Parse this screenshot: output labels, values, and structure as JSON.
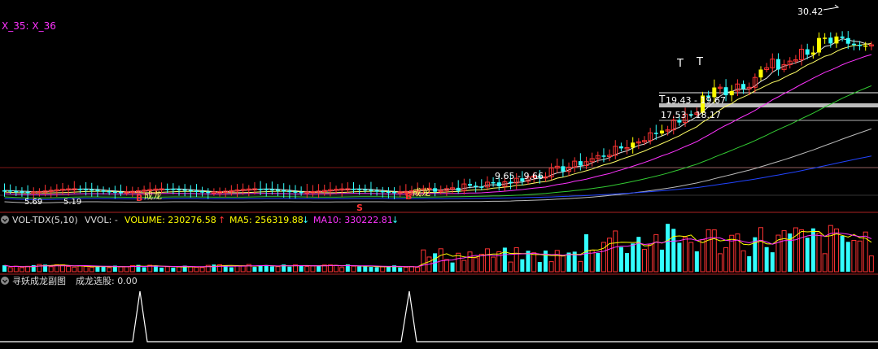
{
  "main_panel": {
    "legend": "X_35: X_36",
    "legend_color": "#ff33ff",
    "top_label": "30.42",
    "price_labels": [
      "19.43 - 19.67",
      "17.53 - 18.17",
      "9.65 - 9.66"
    ],
    "low_label": "5.69",
    "low_label_2": "5.19",
    "cheng_long_1": "成龙",
    "cheng_long_2": "成龙",
    "signal_b_1": "B",
    "signal_b_2": "B",
    "signal_s": "S",
    "marker_t1": "T",
    "marker_t2": "T",
    "marker_t3": "T"
  },
  "volume_panel": {
    "indicator": "VOL-TDX(5,10)",
    "vvol": "VVOL: -",
    "volume_label": "VOLUME: 230276.58",
    "volume_arrow": "↑",
    "ma5_label": "MA5: 256319.88",
    "ma5_arrow": "↓",
    "ma10_label": "MA10: 330222.81",
    "ma10_arrow": "↓",
    "colors": {
      "volume": "#ffff00",
      "ma5": "#ffff00",
      "ma10": "#ff33ff",
      "up_arrow": "#ff3333",
      "down_arrow": "#33ffff"
    }
  },
  "sub_panel": {
    "title": "寻妖成龙副图",
    "stock_pick_label": "成龙选股: 0.00"
  },
  "colors": {
    "background": "#000000",
    "up_candle": "#ff3333",
    "down_candle": "#33ffff",
    "yellow_candle": "#ffff00",
    "ma_white": "#e0e0e0",
    "ma_yellow": "#ffff66",
    "ma_magenta": "#ff33ff",
    "ma_green": "#33cc33",
    "ma_gray": "#bbbbbb",
    "ma_blue": "#2244ff"
  }
}
